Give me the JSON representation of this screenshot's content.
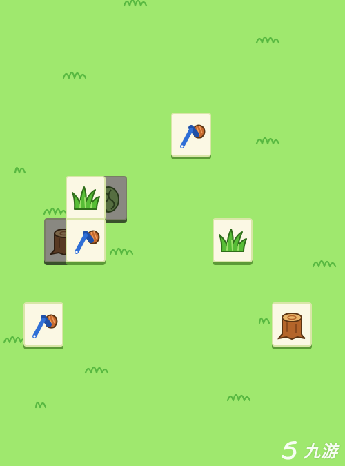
{
  "board": {
    "background_color": "#9fe86e",
    "tuft_color": "#58b841",
    "tiles": [
      {
        "icon": "tree-stump-icon",
        "state": "covered"
      },
      {
        "icon": "cabbage-icon",
        "state": "covered"
      },
      {
        "icon": "brush-icon",
        "state": "free"
      },
      {
        "icon": "grass-icon",
        "state": "free"
      },
      {
        "icon": "brush-icon",
        "state": "free"
      },
      {
        "icon": "grass-icon",
        "state": "free"
      },
      {
        "icon": "brush-icon",
        "state": "free"
      },
      {
        "icon": "tree-stump-icon",
        "state": "free"
      }
    ]
  },
  "watermark": {
    "text": "九游",
    "icon": "jiuyou-logo"
  }
}
